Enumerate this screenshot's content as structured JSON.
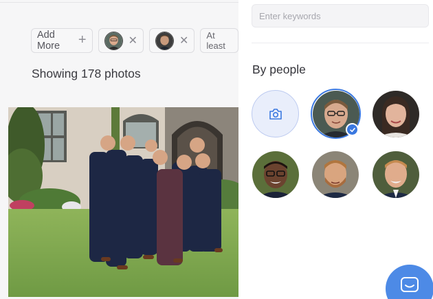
{
  "filters": {
    "add_label": "Add More",
    "add_icon": "plus-icon",
    "chip_3_label": "At least"
  },
  "results": {
    "count_text": "Showing 178 photos"
  },
  "panel": {
    "search_placeholder": "Enter keywords",
    "section_title": "By people",
    "camera_icon": "camera-icon"
  },
  "colors": {
    "accent": "#3a78e0",
    "camera_tile_bg": "#e9eefb",
    "chat_button": "#4d8ae6"
  }
}
